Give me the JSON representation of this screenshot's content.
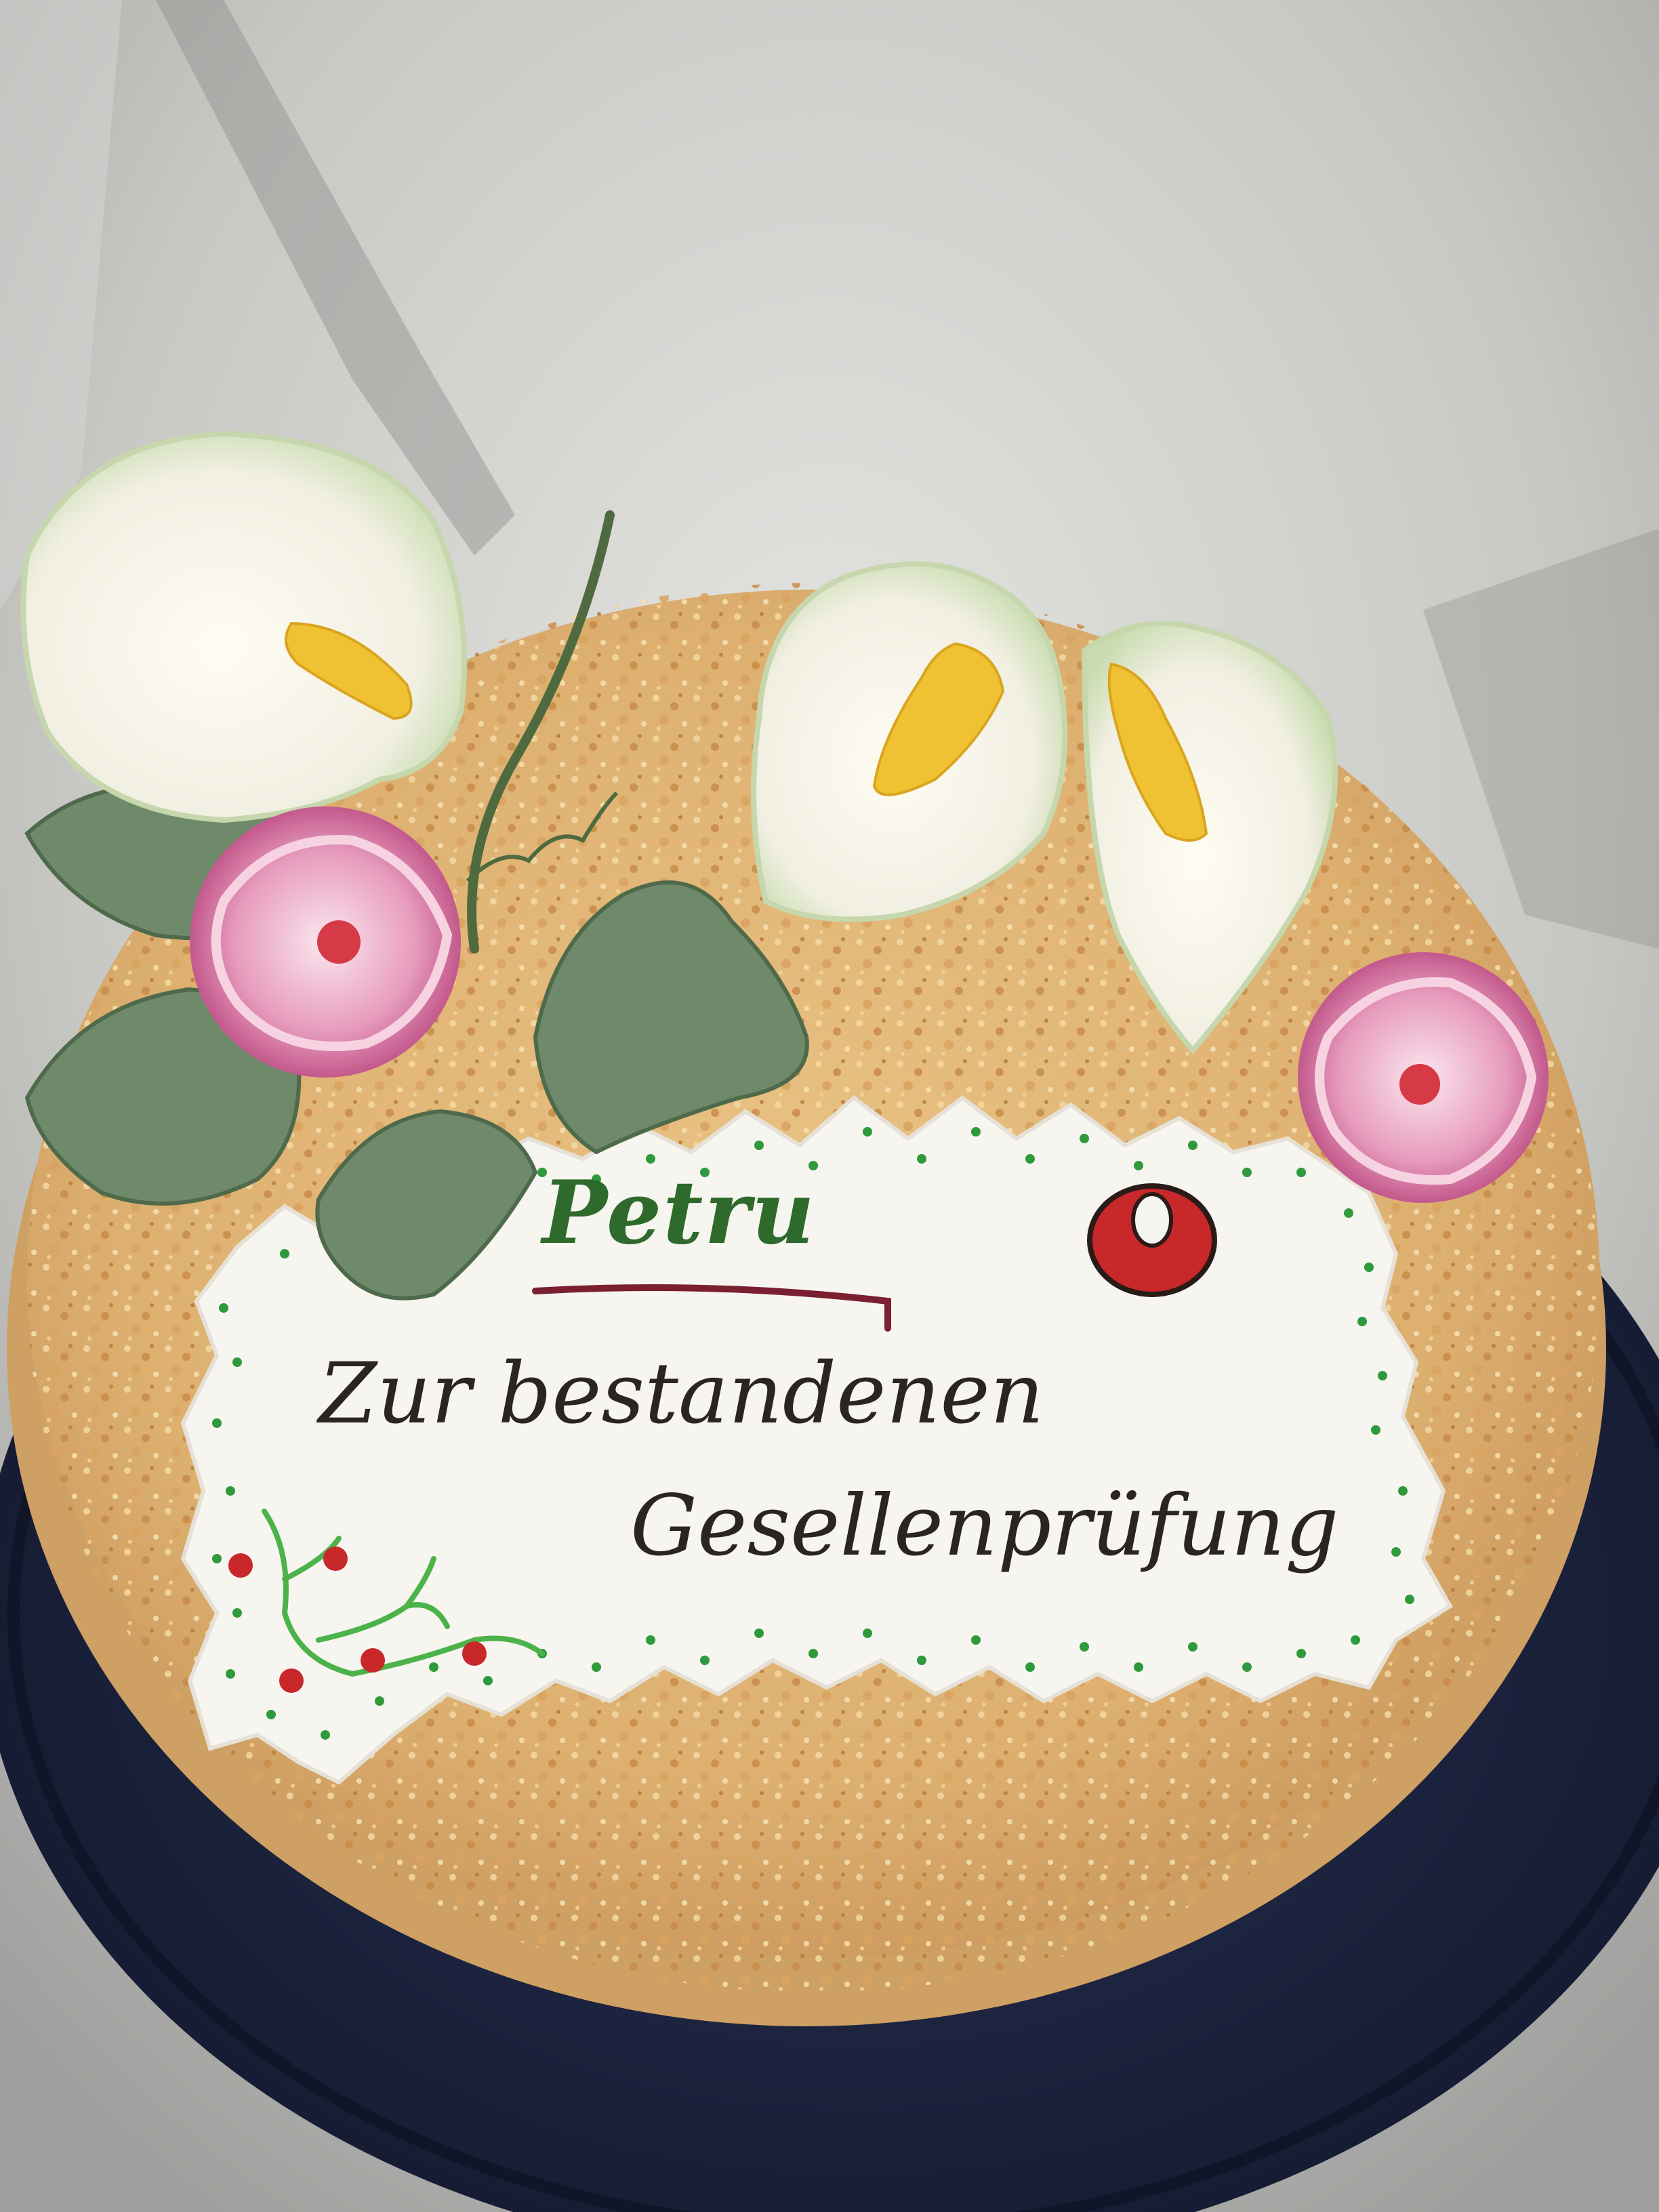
{
  "photo": {
    "subject": "celebration cake",
    "plaque": {
      "name": "Petru",
      "line1": "Zur bestandenen",
      "line2": "Gesellenprüfung"
    }
  },
  "colors": {
    "table_glass": "#c9c9c6",
    "cake_plate": "#1f2540",
    "cake_crumb": "#e0b574",
    "plaque_white": "#f7f5f0",
    "sugar_leaf": "#6f8a6a",
    "rose_pink": "#d97aa6",
    "calla_white": "#f4f2e8",
    "calla_spadix": "#f0c233",
    "dot_green": "#2e9a3c",
    "berry_red": "#c8282a"
  }
}
